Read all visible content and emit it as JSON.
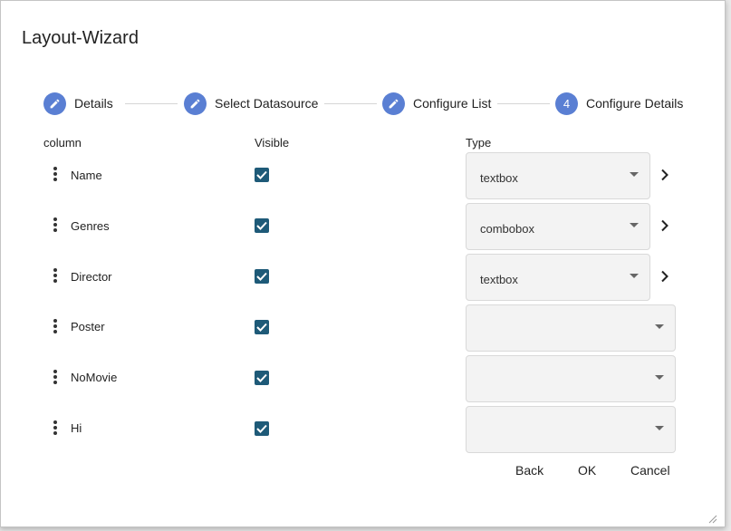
{
  "window": {
    "title": "Layout-Wizard"
  },
  "steps": [
    {
      "label": "Details",
      "icon": "pencil-icon"
    },
    {
      "label": "Select Datasource",
      "icon": "pencil-icon"
    },
    {
      "label": "Configure List",
      "icon": "pencil-icon"
    },
    {
      "label": "Configure Details",
      "number": "4"
    }
  ],
  "columns": {
    "column": "column",
    "visible": "Visible",
    "type": "Type"
  },
  "rows": [
    {
      "name": "Name",
      "visible": true,
      "type": "textbox"
    },
    {
      "name": "Genres",
      "visible": true,
      "type": "combobox"
    },
    {
      "name": "Director",
      "visible": true,
      "type": "textbox"
    },
    {
      "name": "Poster",
      "visible": true,
      "type": ""
    },
    {
      "name": "NoMovie",
      "visible": true,
      "type": ""
    },
    {
      "name": "Hi",
      "visible": true,
      "type": ""
    }
  ],
  "actions": {
    "back": "Back",
    "ok": "OK",
    "cancel": "Cancel"
  },
  "colors": {
    "accent": "#5a7fd3",
    "checkbox": "#1e5a78",
    "select_bg": "#f3f3f3"
  }
}
